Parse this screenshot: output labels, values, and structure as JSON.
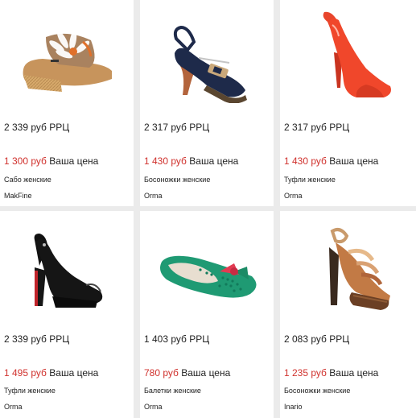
{
  "products": [
    {
      "rrc": "2 339 руб РРЦ",
      "price": "1 300 руб",
      "price_label": "Ваша цена",
      "name": "Сабо женские",
      "brand": "MakFine",
      "image": "mule-sandal-wedge"
    },
    {
      "rrc": "2 317 руб РРЦ",
      "price": "1 430 руб",
      "price_label": "Ваша цена",
      "name": "Босоножки женские",
      "brand": "Orma",
      "image": "slingback-heel"
    },
    {
      "rrc": "2 317 руб РРЦ",
      "price": "1 430 руб",
      "price_label": "Ваша цена",
      "name": "Туфли женские",
      "brand": "Orma",
      "image": "red-peep-toe-pump"
    },
    {
      "rrc": "2 339 руб РРЦ",
      "price": "1 495 руб",
      "price_label": "Ваша цена",
      "name": "Туфли женские",
      "brand": "Orma",
      "image": "black-platform-pump"
    },
    {
      "rrc": "1 403 руб РРЦ",
      "price": "780 руб",
      "price_label": "Ваша цена",
      "name": "Балетки женские",
      "brand": "Orma",
      "image": "green-ballet-flat"
    },
    {
      "rrc": "2 083 руб РРЦ",
      "price": "1 235 руб",
      "price_label": "Ваша цена",
      "name": "Босоножки женские",
      "brand": "Inario",
      "image": "strappy-platform-sandal"
    }
  ]
}
